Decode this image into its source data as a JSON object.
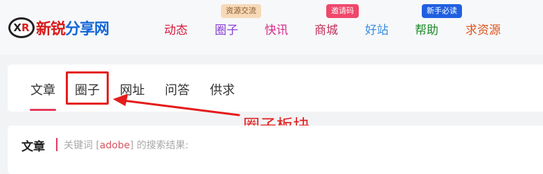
{
  "header": {
    "logo": {
      "badge_x": "X",
      "badge_r": "R",
      "text1": "新锐",
      "text2": "分享网"
    },
    "nav": [
      {
        "label": "动态",
        "color": "#d71a3a"
      },
      {
        "label": "圈子",
        "color": "#8a3fd1",
        "tag": "资源交流",
        "tag_bg": "#f7d9b8",
        "tag_color": "#8a5a2a"
      },
      {
        "label": "快讯",
        "color": "#d92a8a"
      },
      {
        "label": "商城",
        "color": "#c0305a",
        "tag": "邀请码",
        "tag_bg": "#f0476b",
        "tag_color": "#ffffff"
      },
      {
        "label": "好站",
        "color": "#3a8de0"
      },
      {
        "label": "帮助",
        "color": "#1f8a2a",
        "tag": "新手必读",
        "tag_bg": "#1f5fe0",
        "tag_color": "#ffffff"
      },
      {
        "label": "求资源",
        "color": "#e0531f"
      }
    ]
  },
  "tabs": [
    "文章",
    "圈子",
    "网址",
    "问答",
    "供求"
  ],
  "active_tab": "文章",
  "annotation": "圈子板块",
  "result": {
    "title": "文章",
    "prefix": "关键词 [",
    "keyword": "adobe",
    "suffix": "] 的搜索结果:"
  },
  "colors": {
    "accent": "#e23a5a",
    "annotation_red": "#e41c1c"
  }
}
